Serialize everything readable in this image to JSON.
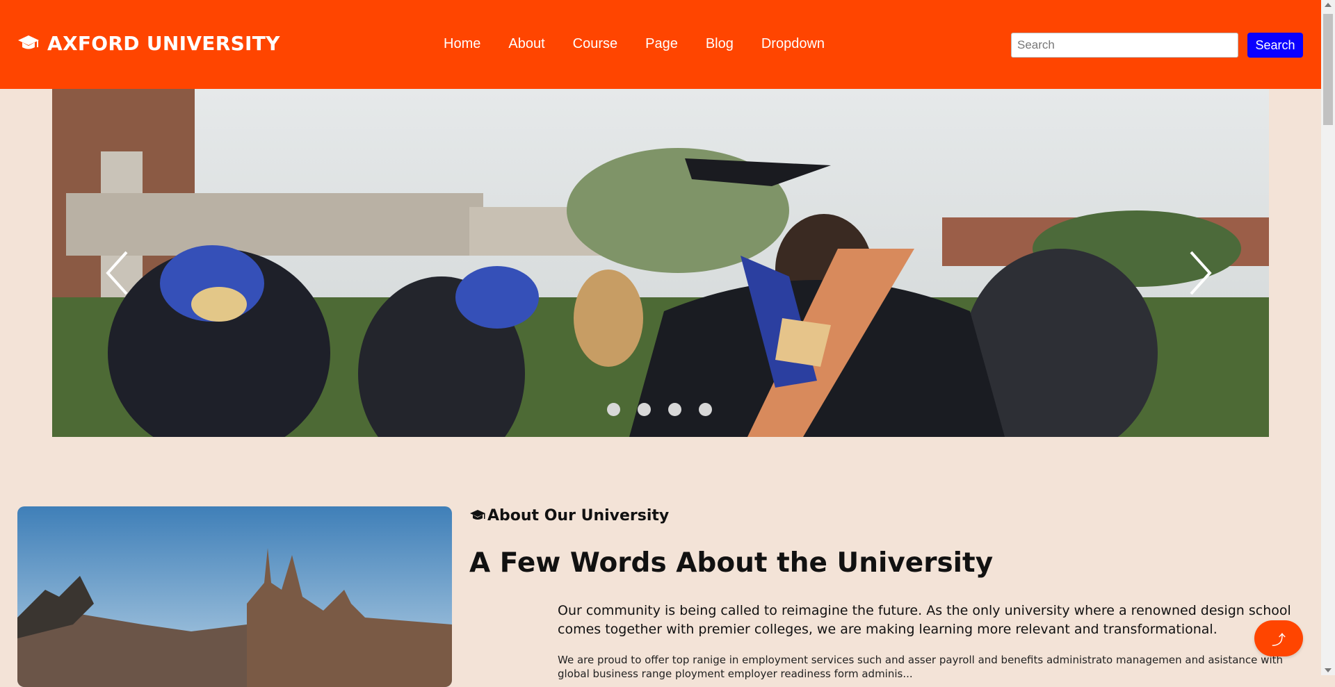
{
  "brand": {
    "name": "AXFORD UNIVERSITY",
    "icon": "graduation-cap-icon"
  },
  "nav": {
    "links": [
      "Home",
      "About",
      "Course",
      "Page",
      "Blog",
      "Dropdown"
    ],
    "search_placeholder": "Search",
    "search_button": "Search"
  },
  "slider": {
    "slide_count": 4,
    "prev_icon": "chevron-left-icon",
    "next_icon": "chevron-right-icon"
  },
  "about": {
    "tag": "About Our University",
    "title": "A Few Words About the University",
    "lead": "Our community is being called to reimagine the future. As the only university where a renowned design school comes together with premier colleges, we are making learning more relevant and transformational.",
    "body": "We are proud to offer top ranige in employment services such and asser payroll and benefits administrato managemen and asistance with global business range ployment employer readiness form adminis..."
  },
  "floating_button": {
    "icon": "up-arrow-icon",
    "label": "⤴"
  },
  "colors": {
    "primary": "#ff4500",
    "search_button": "#0a00ff",
    "background": "#f3e3d7"
  }
}
